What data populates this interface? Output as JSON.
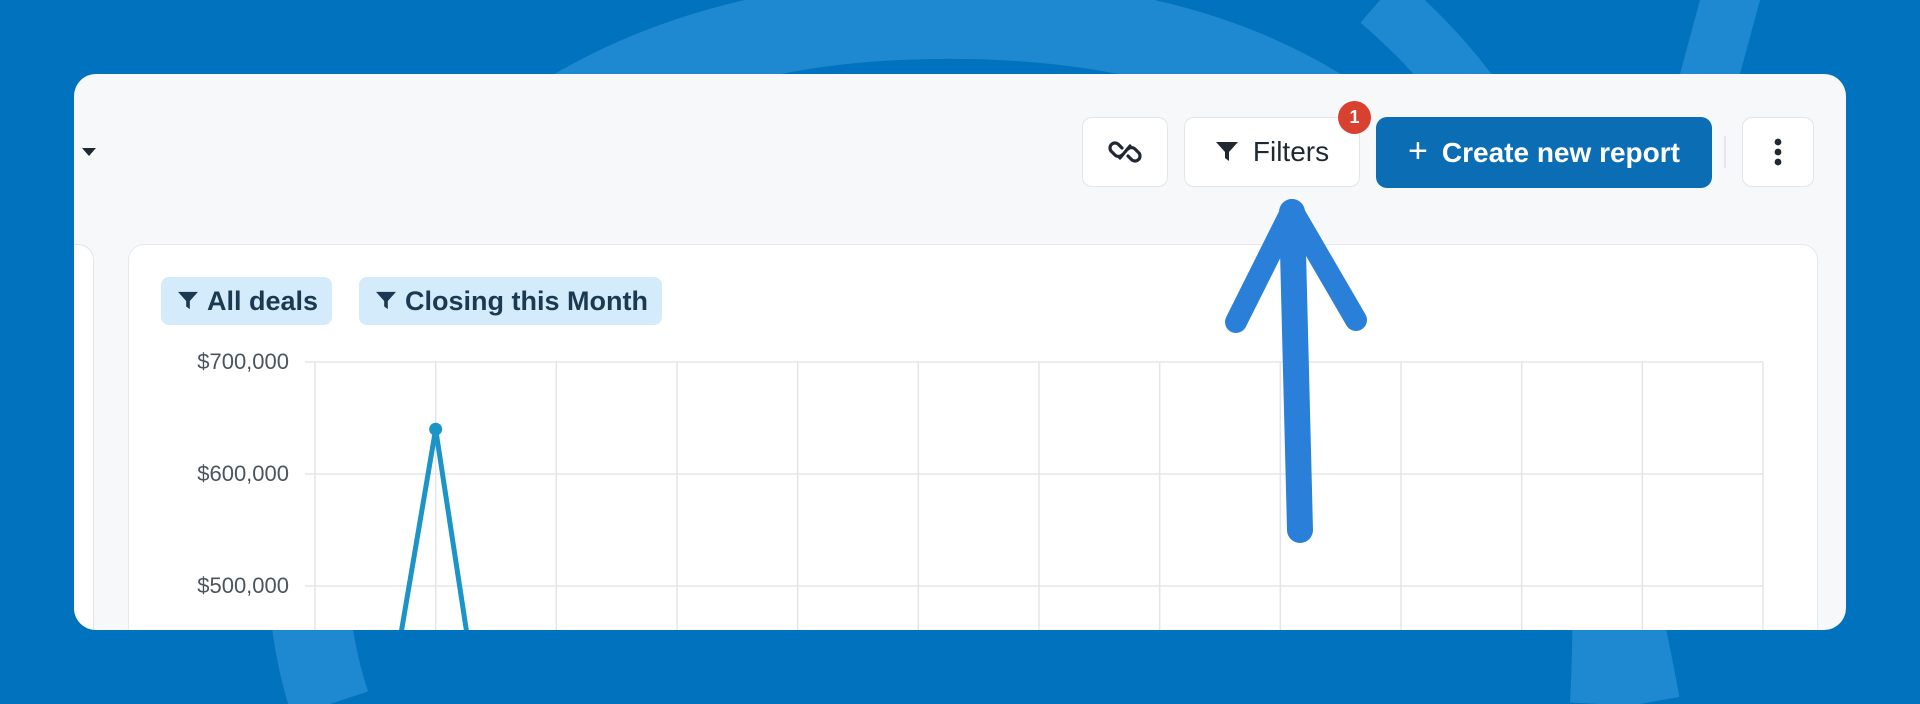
{
  "toolbar": {
    "filters_label": "Filters",
    "filters_badge": "1",
    "create_label": "Create new report",
    "create_plus": "+"
  },
  "filter_chips": [
    {
      "label": "All deals",
      "icon": "funnel-icon"
    },
    {
      "label": "Closing this Month",
      "icon": "funnel-icon"
    }
  ],
  "colors": {
    "background": "#0172bd",
    "card": "#f7f8fa",
    "primary_button": "#0b6db4",
    "badge": "#d8402f",
    "chip": "#d4ebfb",
    "series_line": "#1c94c8",
    "annotation_arrow": "#2a80d8"
  },
  "icons": {
    "link": "link-icon",
    "filter": "funnel-icon",
    "more": "more-vertical-icon",
    "dropdown": "caret-down-icon"
  },
  "chart_data": {
    "type": "line",
    "ylim": [
      400000,
      700000
    ],
    "y_ticks": [
      700000,
      600000,
      500000
    ],
    "y_tick_labels": [
      "$700,000",
      "$600,000",
      "$500,000"
    ],
    "series": [
      {
        "values": [
          null,
          640000,
          null
        ]
      }
    ],
    "x_gridline_count": 13,
    "grid": true
  }
}
